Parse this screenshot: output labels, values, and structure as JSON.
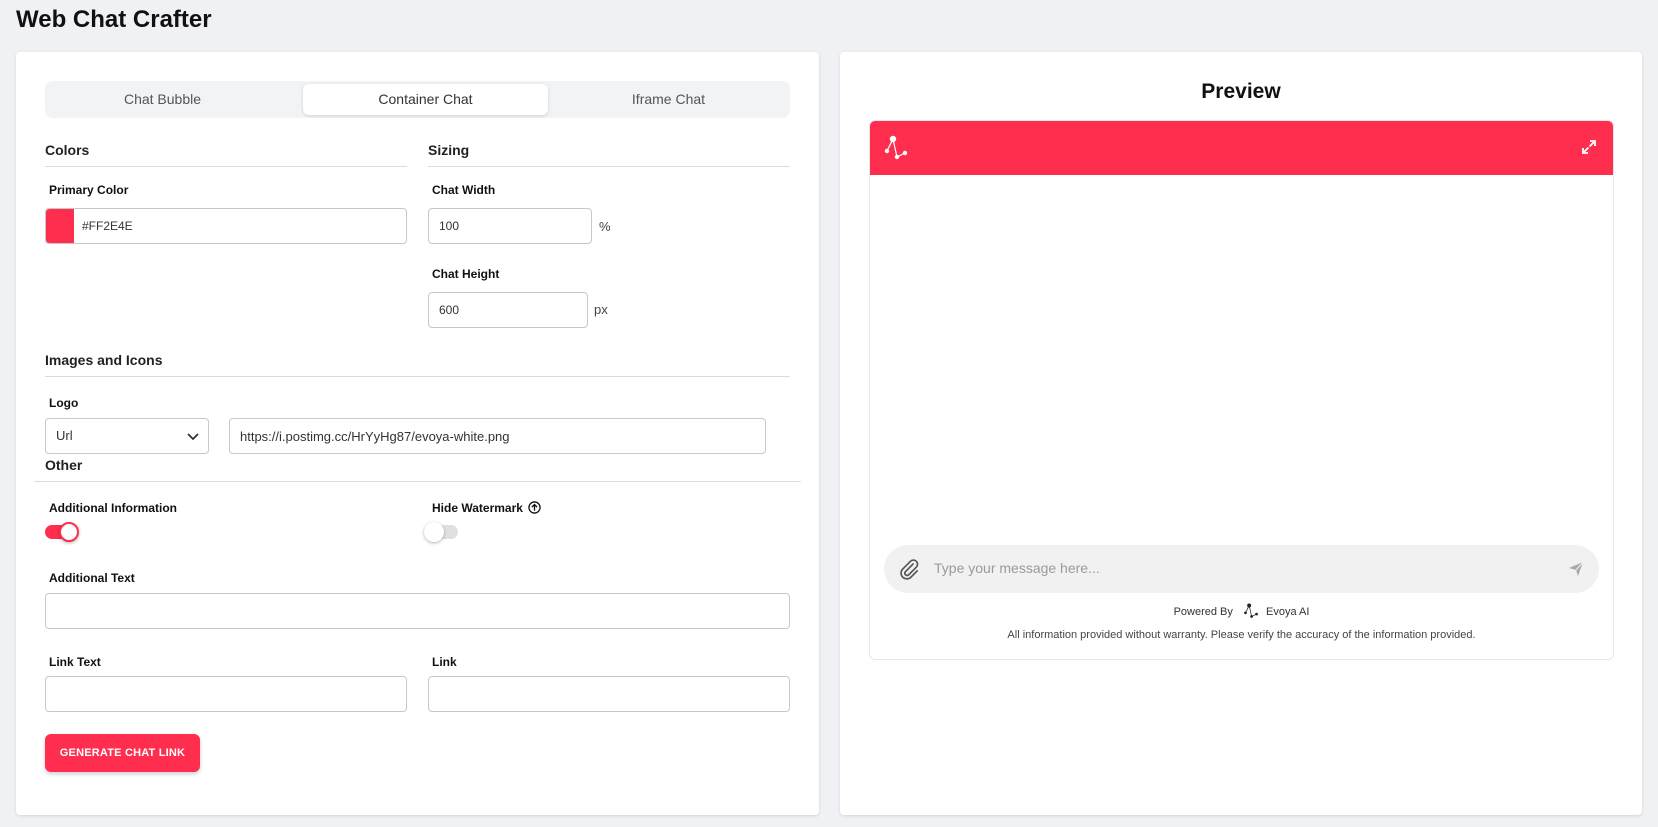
{
  "app": {
    "title": "Web Chat Crafter"
  },
  "tabs": [
    {
      "label": "Chat Bubble",
      "active": false
    },
    {
      "label": "Container Chat",
      "active": true
    },
    {
      "label": "Iframe Chat",
      "active": false
    }
  ],
  "colors": {
    "section_title": "Colors",
    "primary_label": "Primary Color",
    "primary_value": "#FF2E4E"
  },
  "sizing": {
    "section_title": "Sizing",
    "width_label": "Chat Width",
    "width_value": "100",
    "width_unit": "%",
    "height_label": "Chat Height",
    "height_value": "600",
    "height_unit": "px"
  },
  "images": {
    "section_title": "Images and Icons",
    "logo_label": "Logo",
    "logo_source": "Url",
    "logo_url": "https://i.postimg.cc/HrYyHg87/evoya-white.png"
  },
  "other": {
    "section_title": "Other",
    "additional_info_label": "Additional Information",
    "additional_info_on": true,
    "hide_watermark_label": "Hide Watermark",
    "hide_watermark_on": false,
    "additional_text_label": "Additional Text",
    "additional_text_value": "",
    "link_text_label": "Link Text",
    "link_text_value": "",
    "link_label": "Link",
    "link_value": ""
  },
  "actions": {
    "generate_label": "GENERATE CHAT LINK"
  },
  "preview": {
    "title": "Preview",
    "input_placeholder": "Type your message here...",
    "powered_by": "Powered By",
    "brand": "Evoya AI",
    "disclaimer": "All information provided without warranty. Please verify the accuracy of the information provided."
  },
  "theme": {
    "accent": "#FF2E4E",
    "toggle_off": "#e0e0e0"
  }
}
